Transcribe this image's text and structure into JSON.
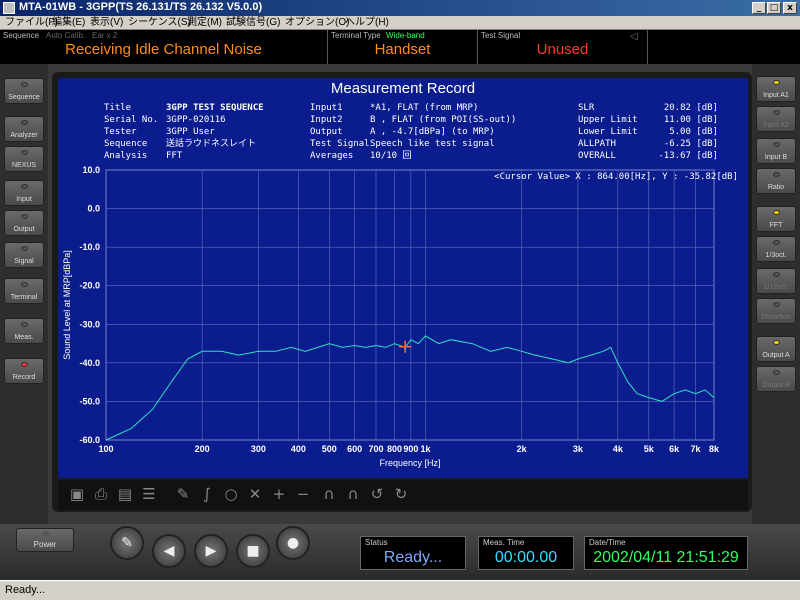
{
  "window": {
    "title": "MTA-01WB - 3GPP(TS 26.131/TS 26.132 V5.0.0)",
    "minimize": "_",
    "maximize": "□",
    "close": "x"
  },
  "menu": [
    "ファイル(F)",
    "編集(E)",
    "表示(V)",
    "シーケンス(S)",
    "測定(M)",
    "試験信号(G)",
    "オプション(O)",
    "ヘルプ(H)"
  ],
  "status_strip": {
    "sequence_label": "Sequence",
    "auto_calib": "Auto Calib.",
    "ear": "Ear x 2",
    "sequence_value": "Receiving Idle Channel Noise",
    "terminal_label": "Terminal Type",
    "terminal_band": "Wide-band",
    "terminal_value": "Handset",
    "signal_label": "Test Signal",
    "signal_value": "Unused"
  },
  "left_buttons": [
    {
      "label": "Sequence",
      "led": "off"
    },
    {
      "label": "Analyzer",
      "led": "off"
    },
    {
      "label": "NEXUS",
      "led": "off"
    },
    {
      "label": "Input",
      "led": "off"
    },
    {
      "label": "Output",
      "led": "off"
    },
    {
      "label": "Signal",
      "led": "off"
    },
    {
      "label": "Terminal",
      "led": "off"
    },
    {
      "label": "Meas.",
      "led": "off"
    },
    {
      "label": "Record",
      "led": "red"
    }
  ],
  "right_buttons": [
    {
      "label": "Input A1",
      "led": "yellow",
      "enabled": true
    },
    {
      "label": "Input A2",
      "led": "off",
      "enabled": false
    },
    {
      "label": "Input B",
      "led": "off",
      "enabled": true
    },
    {
      "label": "Ratio",
      "led": "off",
      "enabled": true
    },
    {
      "label": "FFT",
      "led": "yellow",
      "enabled": true
    },
    {
      "label": "1/3oct.",
      "led": "off",
      "enabled": true
    },
    {
      "label": "1/12oct.",
      "led": "off",
      "enabled": false
    },
    {
      "label": "Distortion",
      "led": "off",
      "enabled": false
    },
    {
      "label": "Output A",
      "led": "yellow",
      "enabled": true
    },
    {
      "label": "Output B",
      "led": "off",
      "enabled": false
    }
  ],
  "record": {
    "heading": "Measurement Record",
    "col1_labels": [
      "Title",
      "Serial No.",
      "Tester",
      "Sequence",
      "Analysis"
    ],
    "col1_values": [
      "3GPP TEST SEQUENCE",
      "3GPP-020116",
      "3GPP User",
      "送話ラウドネスレイト",
      "FFT"
    ],
    "col2_labels": [
      "Input1",
      "Input2",
      "Output",
      "Test Signal",
      "Averages"
    ],
    "col2_values": [
      "*A1, FLAT (from MRP)",
      "B , FLAT (from POI(SS-out))",
      "A , -4.7[dBPa] (to MRP)",
      "Speech like test signal",
      "10/10 回"
    ],
    "col3_labels": [
      "SLR",
      "Upper Limit",
      "Lower Limit",
      "ALLPATH",
      "OVERALL"
    ],
    "col3_values": [
      "20.82 [dB]",
      "11.00 [dB]",
      "5.00 [dB]",
      "-6.25 [dB]",
      "-13.67 [dB]"
    ],
    "cursor_value": "<Cursor Value> X : 864.00[Hz], Y : -35.82[dB]",
    "colors": {
      "screen_bg": "#0b1d8e",
      "trace": "#30e0c0",
      "cursor": "#ff7030",
      "slr_value": "#ff4040"
    }
  },
  "chart_data": {
    "type": "line",
    "xscale": "log",
    "xlim": [
      100,
      8000
    ],
    "ylim": [
      -60,
      10
    ],
    "xlabel": "Frequency [Hz]",
    "ylabel": "Sound Level at MRP[dBPa]",
    "x_ticks": [
      100,
      200,
      300,
      400,
      500,
      600,
      700,
      800,
      900,
      1000,
      2000,
      3000,
      4000,
      5000,
      6000,
      7000,
      8000
    ],
    "x_tick_labels": [
      "100",
      "200",
      "300",
      "400",
      "500",
      "600",
      "700",
      "800",
      "900",
      "1k",
      "2k",
      "3k",
      "4k",
      "5k",
      "6k",
      "7k",
      "8k"
    ],
    "y_ticks": [
      10,
      0,
      -10,
      -20,
      -30,
      -40,
      -50,
      -60
    ],
    "y_tick_labels": [
      "10.0",
      "0.0",
      "-10.0",
      "-20.0",
      "-30.0",
      "-40.0",
      "-50.0",
      "-60.0"
    ],
    "grid": true,
    "cursor": {
      "x": 864,
      "y": -35.82
    },
    "series": [
      {
        "x": [
          100,
          120,
          140,
          160,
          180,
          200,
          230,
          260,
          300,
          340,
          380,
          420,
          460,
          500,
          550,
          600,
          650,
          700,
          750,
          800,
          864,
          900,
          950,
          1000,
          1100,
          1200,
          1400,
          1600,
          1800,
          2000,
          2200,
          2500,
          2800,
          3000,
          3300,
          3600,
          3800,
          4000,
          4300,
          4600,
          5000,
          5500,
          6000,
          6500,
          7000,
          7500,
          8000
        ],
        "y": [
          -60,
          -57,
          -52,
          -45,
          -39,
          -37,
          -37,
          -38,
          -37,
          -37,
          -36,
          -37,
          -36,
          -35,
          -36,
          -35.5,
          -36,
          -35.5,
          -36,
          -35,
          -36,
          -34,
          -35,
          -33,
          -35,
          -34,
          -35,
          -37,
          -36,
          -37,
          -38,
          -39,
          -40,
          -39,
          -38,
          -37,
          -36,
          -40,
          -45,
          -48,
          -49,
          -50,
          -48,
          -47,
          -48,
          -47,
          -49
        ]
      }
    ]
  },
  "bottom": {
    "power_label": "Power",
    "status_label": "Status",
    "status_value": "Ready...",
    "meas_time_label": "Meas. Time",
    "meas_time_value": "00:00.00",
    "datetime_label": "Date/Time",
    "datetime_value": "2002/04/11 21:51:29"
  },
  "os_status": "Ready..."
}
